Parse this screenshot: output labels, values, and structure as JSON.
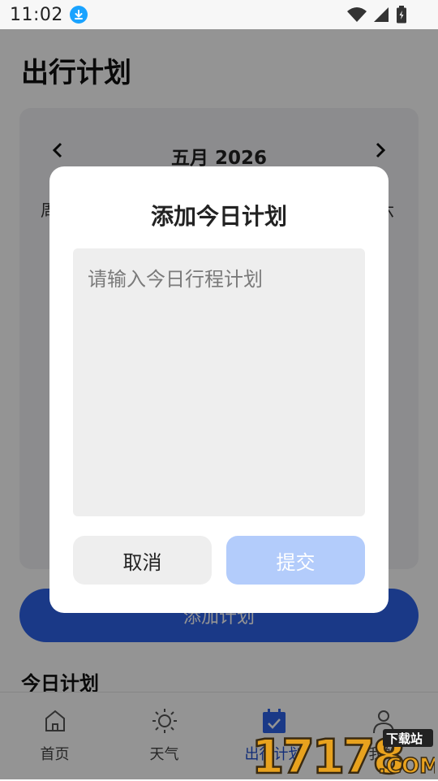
{
  "status_bar": {
    "time": "11:02"
  },
  "page": {
    "title": "出行计划",
    "calendar": {
      "month_label": "五月 2026",
      "weekday_first": "周",
      "weekday_last": "六"
    },
    "add_plan_label": "添加计划",
    "today_heading": "今日计划"
  },
  "bottom_nav": [
    {
      "label": "首页",
      "icon": "home-icon"
    },
    {
      "label": "天气",
      "icon": "sun-icon"
    },
    {
      "label": "出行计划",
      "icon": "calendar-check-icon",
      "active": true
    },
    {
      "label": "我的",
      "icon": "person-icon"
    }
  ],
  "dialog": {
    "title": "添加今日计划",
    "placeholder": "请输入今日行程计划",
    "cancel_label": "取消",
    "submit_label": "提交"
  },
  "watermark": {
    "number": "17178",
    "site": "下载站",
    "suffix": ".COM"
  },
  "colors": {
    "primary": "#2d63e8",
    "submit_disabled": "#b3ccfb",
    "dialog_bg": "#ffffff"
  }
}
